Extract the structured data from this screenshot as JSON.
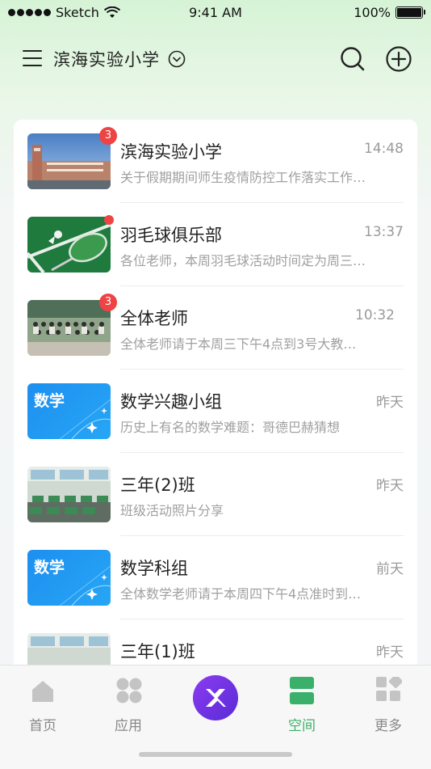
{
  "status_bar": {
    "carrier": "Sketch",
    "time": "9:41 AM",
    "battery_percent": "100%",
    "battery_level": 1.0
  },
  "header": {
    "school_name": "滨海实验小学"
  },
  "chats": [
    {
      "title": "滨海实验小学",
      "time": "14:48",
      "preview": "关于假期期间师生疫情防控工作落实工作…",
      "badge": "3",
      "thumb": "school-building-photo"
    },
    {
      "title": "羽毛球俱乐部",
      "time": "13:37",
      "preview": "各位老师，本周羽毛球活动时间定为周三…",
      "badge": "",
      "unread_dot": true,
      "thumb": "badminton-photo"
    },
    {
      "title": "全体老师",
      "time": "10:32",
      "preview": "全体老师请于本周三下午4点到3号大教…",
      "badge": "3",
      "thumb": "teachers-group-photo"
    },
    {
      "title": "数学兴趣小组",
      "time": "昨天",
      "preview": "历史上有名的数学难题：哥德巴赫猜想",
      "badge": "",
      "thumb": "math-cover",
      "thumb_text": "数学"
    },
    {
      "title": "三年(2)班",
      "time": "昨天",
      "preview": "班级活动照片分享",
      "badge": "",
      "thumb": "classroom-photo"
    },
    {
      "title": "数学科组",
      "time": "前天",
      "preview": "全体数学老师请于本周四下午4点准时到…",
      "badge": "",
      "thumb": "math-cover",
      "thumb_text": "数学"
    },
    {
      "title": "三年(1)班",
      "time": "昨天",
      "preview": "",
      "badge": "",
      "thumb": "classroom-photo"
    }
  ],
  "tabs": [
    {
      "label": "首页",
      "icon": "home-icon",
      "active": false
    },
    {
      "label": "应用",
      "icon": "apps-icon",
      "active": false
    },
    {
      "label": "",
      "icon": "x-logo-icon",
      "active": false
    },
    {
      "label": "空间",
      "icon": "space-icon",
      "active": true
    },
    {
      "label": "更多",
      "icon": "more-icon",
      "active": false
    }
  ],
  "colors": {
    "accent_green": "#3bb06a",
    "badge_red": "#ee4444",
    "center_button": "#7a34e8",
    "math_blue": "#1f8fe8"
  }
}
